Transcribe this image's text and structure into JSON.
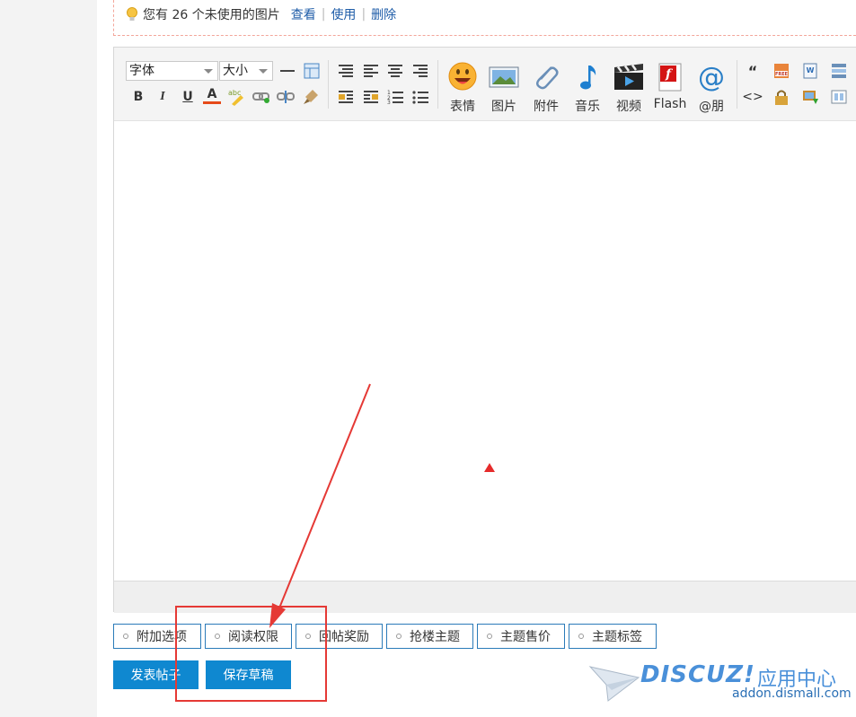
{
  "notice": {
    "text": "您有 26 个未使用的图片",
    "view_link": "查看",
    "use_link": "使用",
    "delete_link": "删除"
  },
  "toolbar": {
    "font_select": "字体",
    "size_select": "大小",
    "big_buttons": [
      {
        "label": "表情",
        "icon": "emoji-icon"
      },
      {
        "label": "图片",
        "icon": "image-icon"
      },
      {
        "label": "附件",
        "icon": "attachment-icon"
      },
      {
        "label": "音乐",
        "icon": "music-icon"
      },
      {
        "label": "视频",
        "icon": "video-icon"
      },
      {
        "label": "Flash",
        "icon": "flash-icon"
      },
      {
        "label": "@朋",
        "icon": "at-icon"
      }
    ],
    "format_buttons": {
      "bold": "B",
      "italic": "I",
      "underline": "U",
      "color": "A"
    },
    "quote_glyph": "“",
    "code_glyph": "<>"
  },
  "options": [
    "附加选项",
    "阅读权限",
    "回帖奖励",
    "抢楼主题",
    "主题售价",
    "主题标签"
  ],
  "actions": {
    "post": "发表帖子",
    "draft": "保存草稿"
  },
  "watermark": {
    "brand": "DISCUZ!",
    "cn": "应用中心",
    "domain": "addon.dismall.com"
  },
  "colors": {
    "accent": "#0f88d0",
    "annotation": "#e53935"
  }
}
